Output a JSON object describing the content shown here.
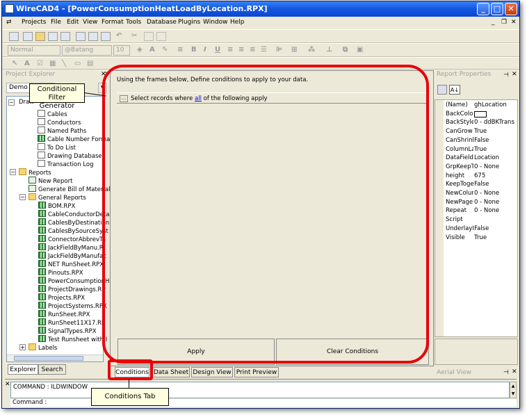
{
  "window": {
    "title": "WireCAD4 - [PowerConsumptionHeatLoadByLocation.RPX]"
  },
  "menu": [
    "Projects",
    "File",
    "Edit",
    "View",
    "Format",
    "Tools",
    "Database",
    "Plugins",
    "Window",
    "Help"
  ],
  "format_bar": {
    "style": "Normal",
    "font": "@Batang",
    "size": "10"
  },
  "explorer": {
    "title": "Project Explorer",
    "project": "Demo P",
    "drawings": "Draw",
    "items": [
      "Cables",
      "Conductors",
      "Named Paths",
      "Cable Number Forma",
      "To Do List",
      "Drawing Database",
      "Transaction Log"
    ],
    "reports": "Reports",
    "report_actions": [
      "New Report",
      "Generate Bill of Materials"
    ],
    "general_reports": "General Reports",
    "report_files": [
      "BOM.RPX",
      "CableConductorDeta",
      "CablesByDestination",
      "CablesBySourceSyst",
      "ConnectorAbbrevTa",
      "JackFieldByManu.RI",
      "JackFieldByManufac",
      "NET RunSheet.RPX",
      "Pinouts.RPX",
      "PowerConsumptionH",
      "ProjectDrawings.RP",
      "Projects.RPX",
      "ProjectSystems.RPX",
      "RunSheet.RPX",
      "RunSheet11X17.RP",
      "SignalTypes.RPX",
      "Test Runsheet with I"
    ],
    "labels": "Labels",
    "tabs": [
      "Explorer",
      "Search"
    ]
  },
  "conditions": {
    "instructions": "Using the frames below, Define conditions to apply to your data.",
    "header_pre": "Select records where",
    "header_link": "all",
    "header_post": "of the following apply",
    "apply_label": "Apply",
    "clear_label": "Clear Conditions"
  },
  "view_tabs": [
    "Conditions",
    "Data Sheet",
    "Design View",
    "Print Preview"
  ],
  "properties": {
    "title": "Report Properties",
    "rows": [
      {
        "name": "(Name)",
        "value": "ghLocation"
      },
      {
        "name": "BackColor",
        "value": ""
      },
      {
        "name": "BackStyle",
        "value": "0 - ddBKTrans"
      },
      {
        "name": "CanGrow",
        "value": "True"
      },
      {
        "name": "CanShrink",
        "value": "False"
      },
      {
        "name": "ColumnLay",
        "value": "True"
      },
      {
        "name": "DataField",
        "value": "Location"
      },
      {
        "name": "GrpKeepTo",
        "value": "0 - None"
      },
      {
        "name": "height",
        "value": "675"
      },
      {
        "name": "KeepToget",
        "value": "False"
      },
      {
        "name": "NewColum",
        "value": "0 - None"
      },
      {
        "name": "NewPage",
        "value": "0 - None"
      },
      {
        "name": "Repeat",
        "value": "0 - None"
      },
      {
        "name": "Script",
        "value": ""
      },
      {
        "name": "UnderlayN",
        "value": "False"
      },
      {
        "name": "Visible",
        "value": "True"
      }
    ]
  },
  "aerial": {
    "title": "Aerial View"
  },
  "command": {
    "history": "COMMAND : ILDWINDOW",
    "prompt": "Command :"
  },
  "callouts": {
    "filter": "Conditional Filter Generator",
    "tab": "Conditions Tab"
  },
  "colors": {
    "highlight": "#e8000c",
    "title_blue": "#0a47d0"
  }
}
